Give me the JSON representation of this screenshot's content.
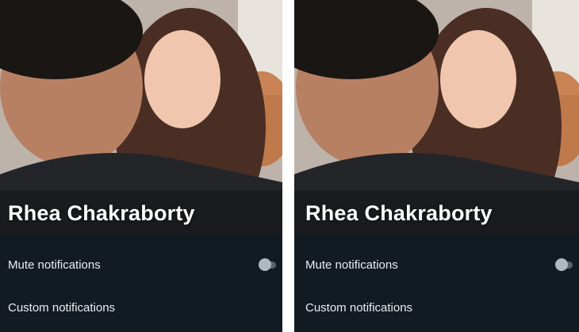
{
  "panels": [
    {
      "contact_name": "Rhea Chakraborty",
      "settings": [
        {
          "label": "Mute notifications",
          "control": "toggle",
          "toggle_on": false
        },
        {
          "label": "Custom notifications"
        }
      ]
    },
    {
      "contact_name": "Rhea Chakraborty",
      "settings": [
        {
          "label": "Mute notifications",
          "control": "toggle",
          "toggle_on": false
        },
        {
          "label": "Custom notifications"
        }
      ]
    }
  ],
  "colors": {
    "background": "#121b22",
    "text_primary": "#e9edef",
    "toggle_off": "#8696a0"
  }
}
